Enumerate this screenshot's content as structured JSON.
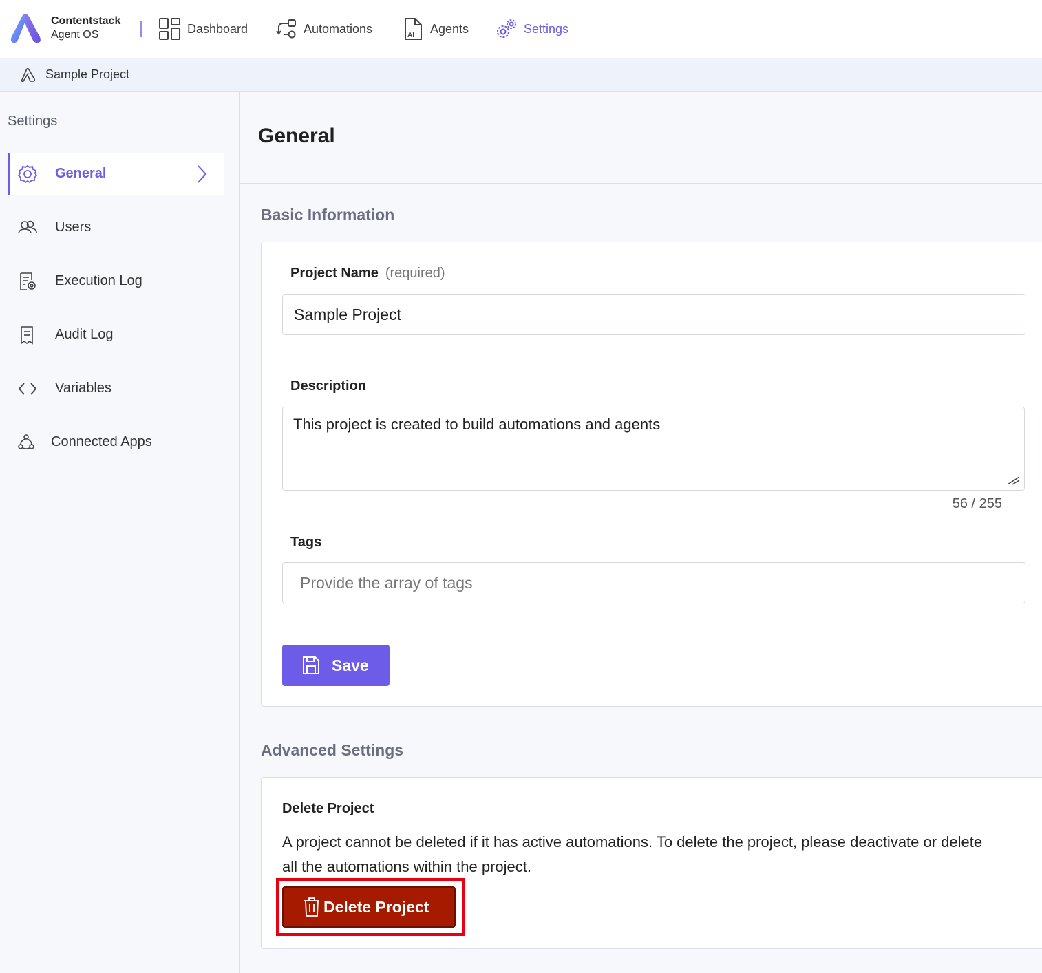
{
  "brand": {
    "name": "Contentstack",
    "product": "Agent OS"
  },
  "topnav": {
    "items": [
      {
        "label": "Dashboard",
        "icon": "dashboard-icon",
        "active": false
      },
      {
        "label": "Automations",
        "icon": "automations-icon",
        "active": false
      },
      {
        "label": "Agents",
        "icon": "agents-icon",
        "active": false
      },
      {
        "label": "Settings",
        "icon": "settings-gears-icon",
        "active": true
      }
    ]
  },
  "project_bar": {
    "name": "Sample Project"
  },
  "sidebar": {
    "title": "Settings",
    "items": [
      {
        "label": "General",
        "icon": "gear-icon",
        "active": true
      },
      {
        "label": "Users",
        "icon": "users-icon",
        "active": false
      },
      {
        "label": "Execution Log",
        "icon": "execution-log-icon",
        "active": false
      },
      {
        "label": "Audit Log",
        "icon": "audit-log-icon",
        "active": false
      },
      {
        "label": "Variables",
        "icon": "code-brackets-icon",
        "active": false
      },
      {
        "label": "Connected Apps",
        "icon": "connected-apps-icon",
        "active": false
      }
    ]
  },
  "main": {
    "title": "General",
    "basic_info": {
      "title": "Basic Information",
      "project_name": {
        "label": "Project Name",
        "hint": "(required)",
        "value": "Sample Project"
      },
      "description": {
        "label": "Description",
        "value": "This project is created to build automations and agents",
        "counter": "56 / 255"
      },
      "tags": {
        "label": "Tags",
        "placeholder": "Provide the array of tags",
        "value": ""
      },
      "save_label": "Save"
    },
    "advanced": {
      "title": "Advanced Settings",
      "delete_title": "Delete Project",
      "delete_text": "A project cannot be deleted if it has active automations. To delete the project, please deactivate or delete all the automations within the project.",
      "delete_label": "Delete Project"
    }
  },
  "colors": {
    "accent": "#6c5ce7",
    "danger": "#a61b00",
    "highlight": "#e60012"
  }
}
